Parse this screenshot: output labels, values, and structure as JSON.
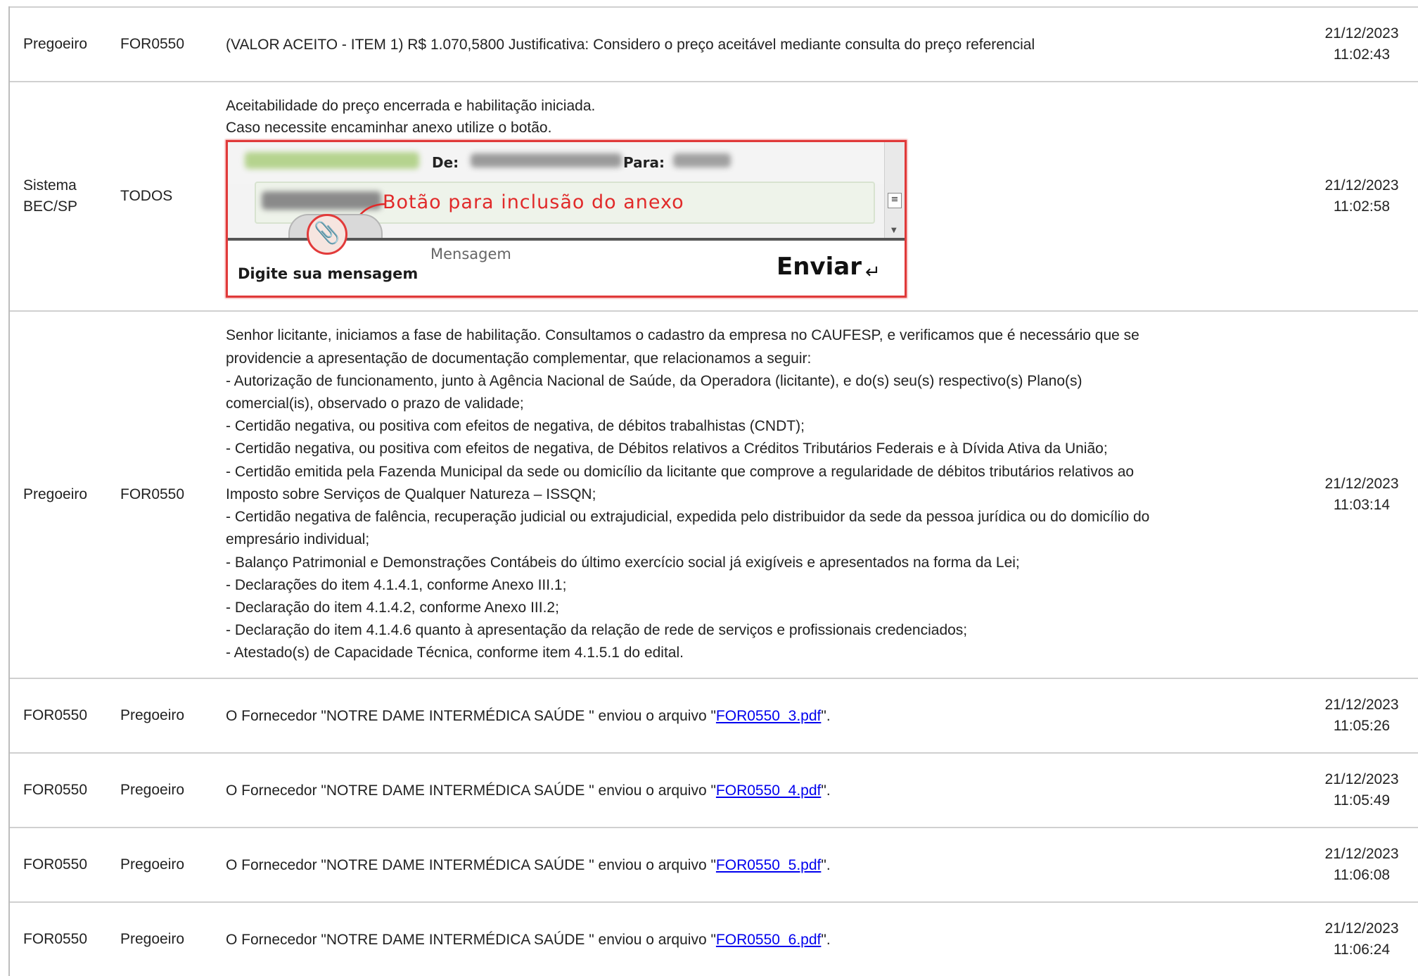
{
  "rows": [
    {
      "from": "Pregoeiro",
      "to": "FOR0550",
      "message": "(VALOR ACEITO - ITEM 1) R$ 1.070,5800 Justificativa: Considero o preço aceitável mediante consulta do preço referencial",
      "date": "21/12/2023",
      "time": "11:02:43"
    },
    {
      "from": "Sistema BEC/SP",
      "to": "TODOS",
      "message_lines": [
        "Aceitabilidade do preço encerrada e habilitação iniciada.",
        "Caso necessite encaminhar anexo utilize o botão."
      ],
      "image": {
        "label_de": "De:",
        "label_para": "Para:",
        "annotation": "Botão para inclusão do anexo",
        "tab_label": "Digite sua mensagem",
        "placeholder": "Mensagem",
        "send_label": "Enviar",
        "send_icon": "↵",
        "attach_icon": "paperclip"
      },
      "date": "21/12/2023",
      "time": "11:02:58"
    },
    {
      "from": "Pregoeiro",
      "to": "FOR0550",
      "message_lines": [
        "Senhor licitante, iniciamos a fase de habilitação. Consultamos o cadastro da empresa no CAUFESP, e verificamos que é necessário que se",
        "providencie a apresentação de documentação complementar, que relacionamos a seguir:",
        "- Autorização de funcionamento, junto à Agência Nacional de Saúde, da Operadora (licitante), e do(s) seu(s) respectivo(s) Plano(s)",
        "comercial(is), observado o prazo de validade;",
        "- Certidão negativa, ou positiva com efeitos de negativa, de débitos trabalhistas (CNDT);",
        "- Certidão negativa, ou positiva com efeitos de negativa, de Débitos relativos a Créditos Tributários Federais e à Dívida Ativa da União;",
        "- Certidão emitida pela Fazenda Municipal da sede ou domicílio da licitante que comprove a regularidade de débitos tributários relativos ao",
        "Imposto sobre Serviços de Qualquer Natureza – ISSQN;",
        "- Certidão negativa de falência, recuperação judicial ou extrajudicial, expedida pelo distribuidor da sede da pessoa jurídica ou do domicílio do",
        "empresário individual;",
        "- Balanço Patrimonial e Demonstrações Contábeis do último exercício social já exigíveis e apresentados na forma da Lei;",
        "- Declarações do item 4.1.4.1, conforme Anexo III.1;",
        "- Declaração do item 4.1.4.2, conforme Anexo III.2;",
        "- Declaração do item 4.1.4.6 quanto à apresentação da relação de rede de serviços e profissionais credenciados;",
        "- Atestado(s) de Capacidade Técnica, conforme item 4.1.5.1 do edital."
      ],
      "date": "21/12/2023",
      "time": "11:03:14"
    },
    {
      "from": "FOR0550",
      "to": "Pregoeiro",
      "prefix": "O Fornecedor \"NOTRE DAME INTERMÉDICA SAÚDE \" enviou o arquivo \"",
      "file": "FOR0550_3.pdf",
      "suffix": "\".",
      "date": "21/12/2023",
      "time": "11:05:26"
    },
    {
      "from": "FOR0550",
      "to": "Pregoeiro",
      "prefix": "O Fornecedor \"NOTRE DAME INTERMÉDICA SAÚDE \" enviou o arquivo \"",
      "file": "FOR0550_4.pdf",
      "suffix": "\".",
      "date": "21/12/2023",
      "time": "11:05:49"
    },
    {
      "from": "FOR0550",
      "to": "Pregoeiro",
      "prefix": "O Fornecedor \"NOTRE DAME INTERMÉDICA SAÚDE \" enviou o arquivo \"",
      "file": "FOR0550_5.pdf",
      "suffix": "\".",
      "date": "21/12/2023",
      "time": "11:06:08"
    },
    {
      "from": "FOR0550",
      "to": "Pregoeiro",
      "prefix": "O Fornecedor \"NOTRE DAME INTERMÉDICA SAÚDE \" enviou o arquivo \"",
      "file": "FOR0550_6.pdf",
      "suffix": "\".",
      "date": "21/12/2023",
      "time": "11:06:24"
    }
  ],
  "colors": {
    "link": "#0000ee",
    "annotation": "#e12a2a",
    "row_border": "#d0d0d0"
  }
}
